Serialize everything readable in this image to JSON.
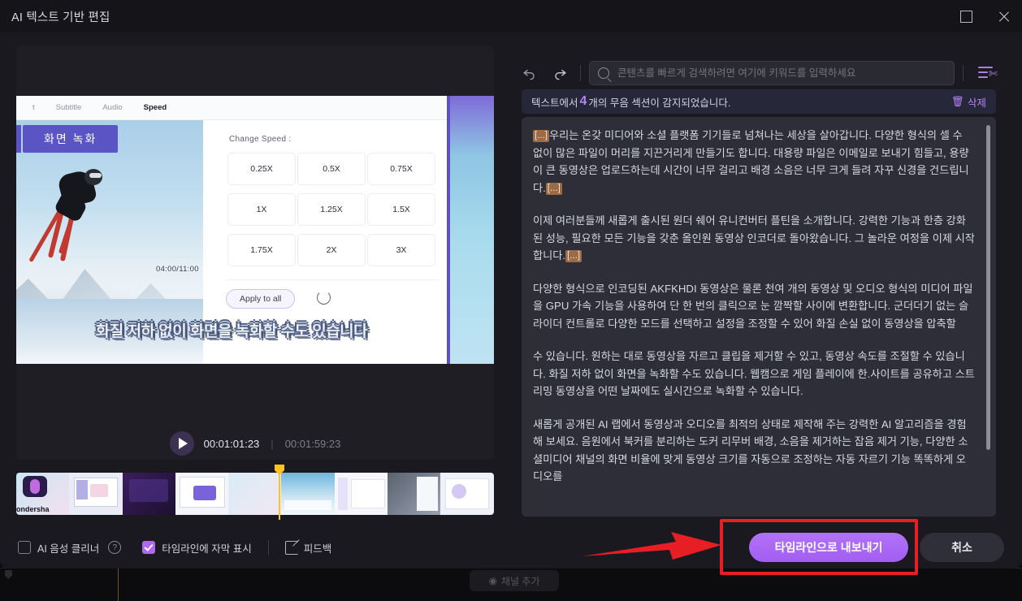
{
  "window": {
    "title": "AI 텍스트 기반 편집",
    "maximize_icon": "maximize-icon",
    "close_icon": "close-icon"
  },
  "preview": {
    "video": {
      "toolbar_items": [
        "t",
        "Subtitle",
        "Audio",
        "Speed"
      ],
      "active_toolbar_item": "Speed",
      "badge_label": "화면 녹화",
      "timecode_overlay": "04:00/11:00",
      "panel_title": "Change Speed :",
      "speeds": [
        "0.25X",
        "0.5X",
        "0.75X",
        "1X",
        "1.25X",
        "1.5X",
        "1.75X",
        "2X",
        "3X"
      ],
      "apply_label": "Apply to all",
      "reset_icon": "reset-icon",
      "subtitle_text": "화질 저하 없이 화면을 녹화할 수도 있습니다"
    },
    "player": {
      "play_icon": "play-icon",
      "current_time": "00:01:01:23",
      "separator": "|",
      "total_time": "00:01:59:23"
    },
    "filmstrip": {
      "playhead_icon": "playhead-marker",
      "thumb_label": "ondersha"
    }
  },
  "toolbar": {
    "undo_icon": "undo-icon",
    "redo_icon": "redo-icon",
    "search_placeholder": "콘텐츠를 빠르게 검색하려면 여기에 키워드를 입력하세요",
    "search_value": "",
    "search_icon": "search-icon",
    "text_cut_icon": "text-cut-icon"
  },
  "detect_banner": {
    "prefix": "텍스트에서",
    "count": "4",
    "suffix": "개의 무음 섹션이 감지되었습니다.",
    "delete_label": "삭제",
    "delete_icon": "trash-icon"
  },
  "transcript": {
    "gap_marker": "[...]",
    "paragraphs": [
      {
        "leading_gap": true,
        "text": "우리는 온갖 미디어와 소셜 플랫폼 기기들로 넘쳐나는 세상을 살아갑니다. 다양한 형식의 셀 수 없이 많은 파일이 머리를 지끈거리게 만들기도 합니다. 대용량 파일은 이메일로 보내기 힘들고, 용량이 큰 동영상은 업로드하는데 시간이 너무 걸리고 배경 소음은 너무 크게 들려 자꾸 신경을 건드립니다.",
        "trailing_gap": true
      },
      {
        "leading_gap": false,
        "text": "이제 여러분들께 새롭게 출시된 원더 쉐어 유니컨버터 플틴을 소개합니다. 강력한 기능과 한층 강화된 성능, 필요한 모든 기능을 갖춘 올인원 동영상 인코더로 돌아왔습니다. 그 놀라운 여정을 이제 시작합니다.",
        "trailing_gap": true
      },
      {
        "leading_gap": false,
        "text": "다양한 형식으로 인코딩된 AKFKHDI 동영상은 물론 천여 개의 동영상 및 오디오 형식의 미디어 파일을 GPU 가속 기능을 사용하여 단 한 번의 클릭으로 눈 깜짝할 사이에 변환합니다. 군더더기 없는 슬라이더 컨트롤로 다양한 모드를 선택하고 설정을 조정할 수 있어 화질 손실 없이 동영상을 압축할",
        "trailing_gap": false
      },
      {
        "leading_gap": false,
        "text": " 수 있습니다. 원하는 대로 동영상을 자르고 클립을 제거할 수 있고, 동영상 속도를 조절할 수 있습니다. 화질 저하 없이 화면을 녹화할 수도 있습니다. 웹캠으로 게임 플레이에 한.사이트를 공유하고 스트리밍 동영상을 어떤 날짜에도 실시간으로 녹화할 수 있습니다.",
        "trailing_gap": false
      },
      {
        "leading_gap": false,
        "text": " 새롭게 공개된 AI 랩에서 동영상과 오디오를 최적의 상태로 제작해 주는 강력한 AI 알고리즘을 경험해 보세요. 음원에서 북커를 분리하는 도커 리무버 배경, 소음을 제거하는 잡음 제거 기능, 다양한 소셜미디어 채널의 화면 비율에 맞게 동영상 크기를 자동으로 조정하는 자동 자르기 기능 똑똑하게 오디오를",
        "trailing_gap": false
      }
    ]
  },
  "footer": {
    "voice_cleaner_label": "AI 음성 클리너",
    "voice_cleaner_checked": false,
    "help_icon": "question-icon",
    "help_glyph": "?",
    "show_subtitle_label": "타임라인에 자막 표시",
    "show_subtitle_checked": true,
    "feedback_label": "피드백",
    "feedback_icon": "edit-note-icon",
    "export_label": "타임라인으로 내보내기",
    "cancel_label": "취소"
  },
  "background": {
    "pill_label": "채널 추가",
    "pill_icon": "plus-circle-icon"
  },
  "colors": {
    "accent_purple": "#b267f2",
    "annotation_red": "#e81e25",
    "playhead_yellow": "#ffc21f",
    "gap_marker_brown": "#9b6b46",
    "dialog_bg": "#19191f",
    "text_panel_bg": "#2e2e38"
  }
}
